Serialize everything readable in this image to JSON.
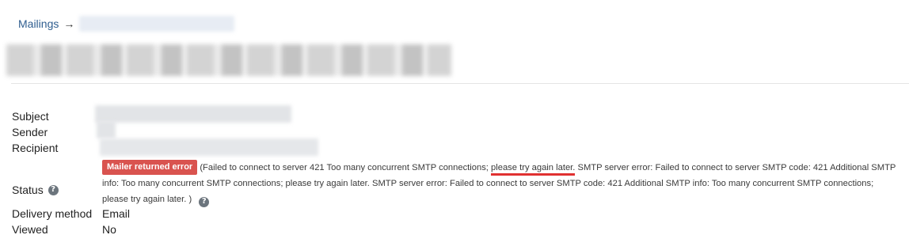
{
  "breadcrumb": {
    "root_label": "Mailings",
    "arrow": "→"
  },
  "details": {
    "subject_label": "Subject",
    "sender_label": "Sender",
    "recipient_label": "Recipient",
    "status_label": "Status",
    "delivery_label": "Delivery method",
    "delivery_value": "Email",
    "viewed_label": "Viewed",
    "viewed_value": "No"
  },
  "status": {
    "badge": "Mailer returned error",
    "msg_before": "(Failed to connect to server 421 Too many concurrent SMTP connections;",
    "msg_highlight": "please try again later.",
    "msg_after": "SMTP server error: Failed to connect to server SMTP code: 421 Additional SMTP info: Too many concurrent SMTP connections; please try again later. SMTP server error: Failed to connect to server SMTP code: 421 Additional SMTP info: Too many concurrent SMTP connections; please try again later. )",
    "badge_color": "#d9534f",
    "highlight_color": "#e03131"
  },
  "icons": {
    "help": "?"
  }
}
